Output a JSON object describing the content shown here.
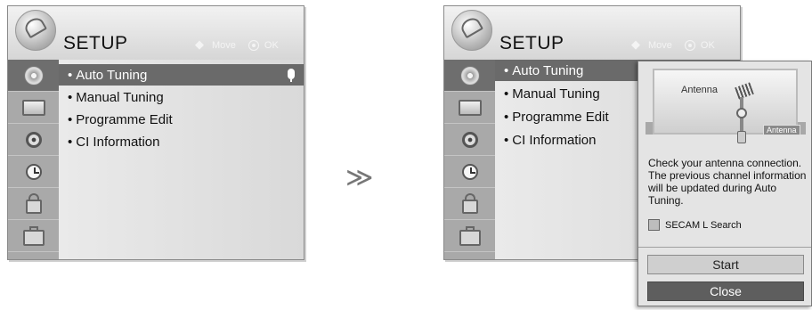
{
  "left_screen": {
    "title": "SETUP",
    "hint_move": "Move",
    "hint_ok": "OK",
    "sidebar": [
      {
        "icon": "disc-icon",
        "active": true
      },
      {
        "icon": "tv-icon",
        "active": false
      },
      {
        "icon": "speaker-icon",
        "active": false
      },
      {
        "icon": "clock-icon",
        "active": false
      },
      {
        "icon": "lock-icon",
        "active": false
      },
      {
        "icon": "briefcase-icon",
        "active": false
      }
    ],
    "menu_items": [
      {
        "label": "Auto Tuning",
        "selected": true
      },
      {
        "label": "Manual Tuning",
        "selected": false
      },
      {
        "label": "Programme Edit",
        "selected": false
      },
      {
        "label": "CI Information",
        "selected": false
      }
    ]
  },
  "arrow": "≫",
  "right_screen": {
    "title": "SETUP",
    "hint_move": "Move",
    "hint_ok": "OK",
    "menu_items": [
      {
        "label": "Auto Tuning",
        "selected": true
      },
      {
        "label": "Manual Tuning",
        "selected": false
      },
      {
        "label": "Programme Edit",
        "selected": false
      },
      {
        "label": "CI Information",
        "selected": false
      }
    ],
    "popup": {
      "image_label": "Antenna",
      "image_tag": "Antenna",
      "message": "Check your antenna connection. The previous channel information will be updated during Auto Tuning.",
      "checkbox_label": "SECAM L Search",
      "start_label": "Start",
      "close_label": "Close"
    }
  },
  "colors": {
    "selected_row": "#6a6a6a",
    "sidebar": "#a9a9a9",
    "close_button": "#5e5e5e"
  }
}
